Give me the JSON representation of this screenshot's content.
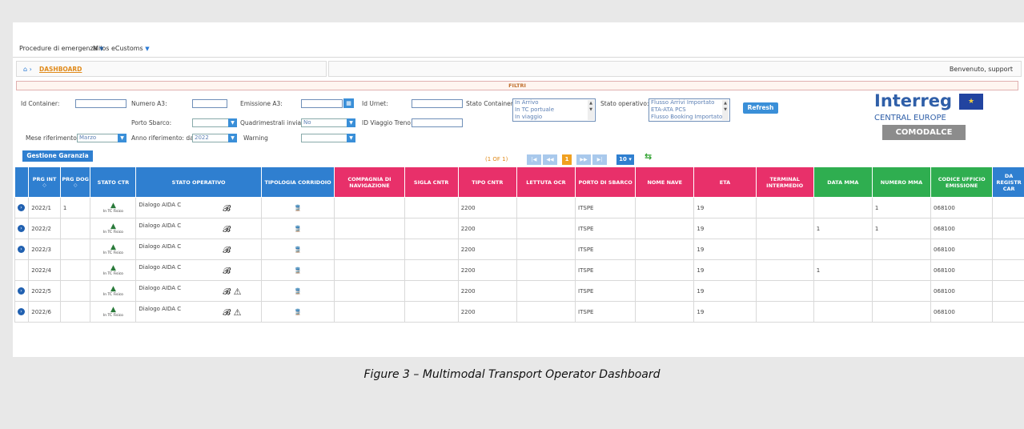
{
  "menu": {
    "items": [
      "Procedure di emergenza",
      "Milos eCustoms"
    ]
  },
  "breadcrumb": {
    "current": "DASHBOARD"
  },
  "welcome": "Benvenuto, support",
  "filters": {
    "title": "FILTRI",
    "id_container": "Id Container:",
    "numero_a3": "Numero A3:",
    "emissione_a3": "Emissione A3:",
    "id_urnet": "Id Urnet:",
    "stato_container": "Stato Container:",
    "stato_container_options": [
      "In Arrivo",
      "In TC portuale",
      "In viaggio"
    ],
    "stato_operativo": "Stato operativo:",
    "stato_operativo_options": [
      "Flusso Arrivi Importato",
      "ETA-ATA PCS",
      "Flusso Booking Importato"
    ],
    "refresh": "Refresh",
    "porto_sbarco": "Porto Sbarco:",
    "quadrimestrali": "Quadrimestrali inviati",
    "quadrimestrali_value": "No",
    "id_viaggio": "ID Viaggio Treno:",
    "mese": "Mese riferimento:",
    "mese_value": "Marzo",
    "anno": "Anno riferimento: dal",
    "anno_value": "2022",
    "warning": "Warning"
  },
  "logo": {
    "interreg": "Interreg",
    "central_europe": "CENTRAL EUROPE",
    "project": "COMODALCE"
  },
  "gestione_button": "Gestione Garanzia",
  "pager": {
    "count": "(1 OF 1)",
    "current": "1",
    "page_size": "10"
  },
  "columns": [
    "",
    "PRG INT",
    "PRG DOG",
    "STATO CTR",
    "STATO OPERATIVO",
    "TIPOLOGIA CORRIDOIO",
    "COMPAGNIA DI NAVIGAZIONE",
    "SIGLA CNTR",
    "TIPO CNTR",
    "LETTUTA OCR",
    "PORTO DI SBARCO",
    "NOME NAVE",
    "ETA",
    "TERMINAL INTERMEDIO",
    "DATA MMA",
    "NUMERO MMA",
    "CODICE UFFICIO EMISSIONE",
    "DA REGISTR CAR"
  ],
  "container_label": "In TC Fisico",
  "rows": [
    {
      "prg": "2022/1",
      "dog": "1",
      "op": "Dialogo AIDA C",
      "tipo": "2200",
      "porto": "ITSPE",
      "eta": "19",
      "data_mma": "",
      "numero_mma": "1",
      "codice": "068100",
      "warn": false,
      "expand": true
    },
    {
      "prg": "2022/2",
      "dog": "",
      "op": "Dialogo AIDA C",
      "tipo": "2200",
      "porto": "ITSPE",
      "eta": "19",
      "data_mma": "1",
      "numero_mma": "1",
      "codice": "068100",
      "warn": false,
      "expand": true
    },
    {
      "prg": "2022/3",
      "dog": "",
      "op": "Dialogo AIDA C",
      "tipo": "2200",
      "porto": "ITSPE",
      "eta": "19",
      "data_mma": "",
      "numero_mma": "",
      "codice": "068100",
      "warn": false,
      "expand": true
    },
    {
      "prg": "2022/4",
      "dog": "",
      "op": "Dialogo AIDA C",
      "tipo": "2200",
      "porto": "ITSPE",
      "eta": "19",
      "data_mma": "1",
      "numero_mma": "",
      "codice": "068100",
      "warn": false,
      "expand": false
    },
    {
      "prg": "2022/5",
      "dog": "",
      "op": "Dialogo AIDA C",
      "tipo": "2200",
      "porto": "ITSPE",
      "eta": "19",
      "data_mma": "",
      "numero_mma": "",
      "codice": "068100",
      "warn": true,
      "expand": true
    },
    {
      "prg": "2022/6",
      "dog": "",
      "op": "Dialogo AIDA C",
      "tipo": "2200",
      "porto": "ITSPE",
      "eta": "19",
      "data_mma": "",
      "numero_mma": "",
      "codice": "068100",
      "warn": true,
      "expand": true
    }
  ],
  "caption": "Figure 3 – Multimodal Transport Operator Dashboard"
}
